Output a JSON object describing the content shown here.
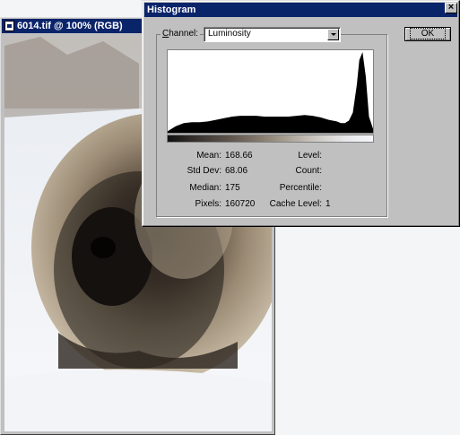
{
  "document": {
    "title": "6014.tif @ 100% (RGB)",
    "icon": "document-icon"
  },
  "dialog": {
    "title": "Histogram",
    "close_symbol": "×",
    "ok_label": "OK",
    "channel": {
      "label_underlined": "C",
      "label_rest": "hannel:",
      "value": "Luminosity"
    },
    "stats_left": [
      {
        "label": "Mean:",
        "value": "168.66"
      },
      {
        "label": "Std Dev:",
        "value": "68.06"
      },
      {
        "label": "Median:",
        "value": "175"
      },
      {
        "label": "Pixels:",
        "value": "160720"
      }
    ],
    "stats_right": [
      {
        "label": "Level:",
        "value": ""
      },
      {
        "label": "Count:",
        "value": ""
      },
      {
        "label": "Percentile:",
        "value": ""
      },
      {
        "label": "Cache Level:",
        "value": "1"
      }
    ]
  },
  "chart_data": {
    "type": "area",
    "x": [
      0,
      10,
      20,
      30,
      40,
      50,
      60,
      70,
      80,
      90,
      100,
      110,
      120,
      130,
      140,
      150,
      160,
      170,
      180,
      190,
      200,
      210,
      215,
      220,
      225,
      230,
      235,
      238,
      242,
      246,
      250,
      255
    ],
    "values": [
      2,
      8,
      12,
      13,
      13,
      14,
      16,
      18,
      20,
      21,
      21,
      21,
      20,
      20,
      20,
      20,
      21,
      22,
      21,
      19,
      16,
      14,
      12,
      12,
      15,
      25,
      60,
      90,
      100,
      70,
      20,
      5
    ],
    "ylim": [
      0,
      100
    ],
    "xlim": [
      0,
      255
    ],
    "color": "#000000"
  },
  "colors": {
    "titlebar": "#0a246a",
    "face": "#c0c0c0"
  }
}
